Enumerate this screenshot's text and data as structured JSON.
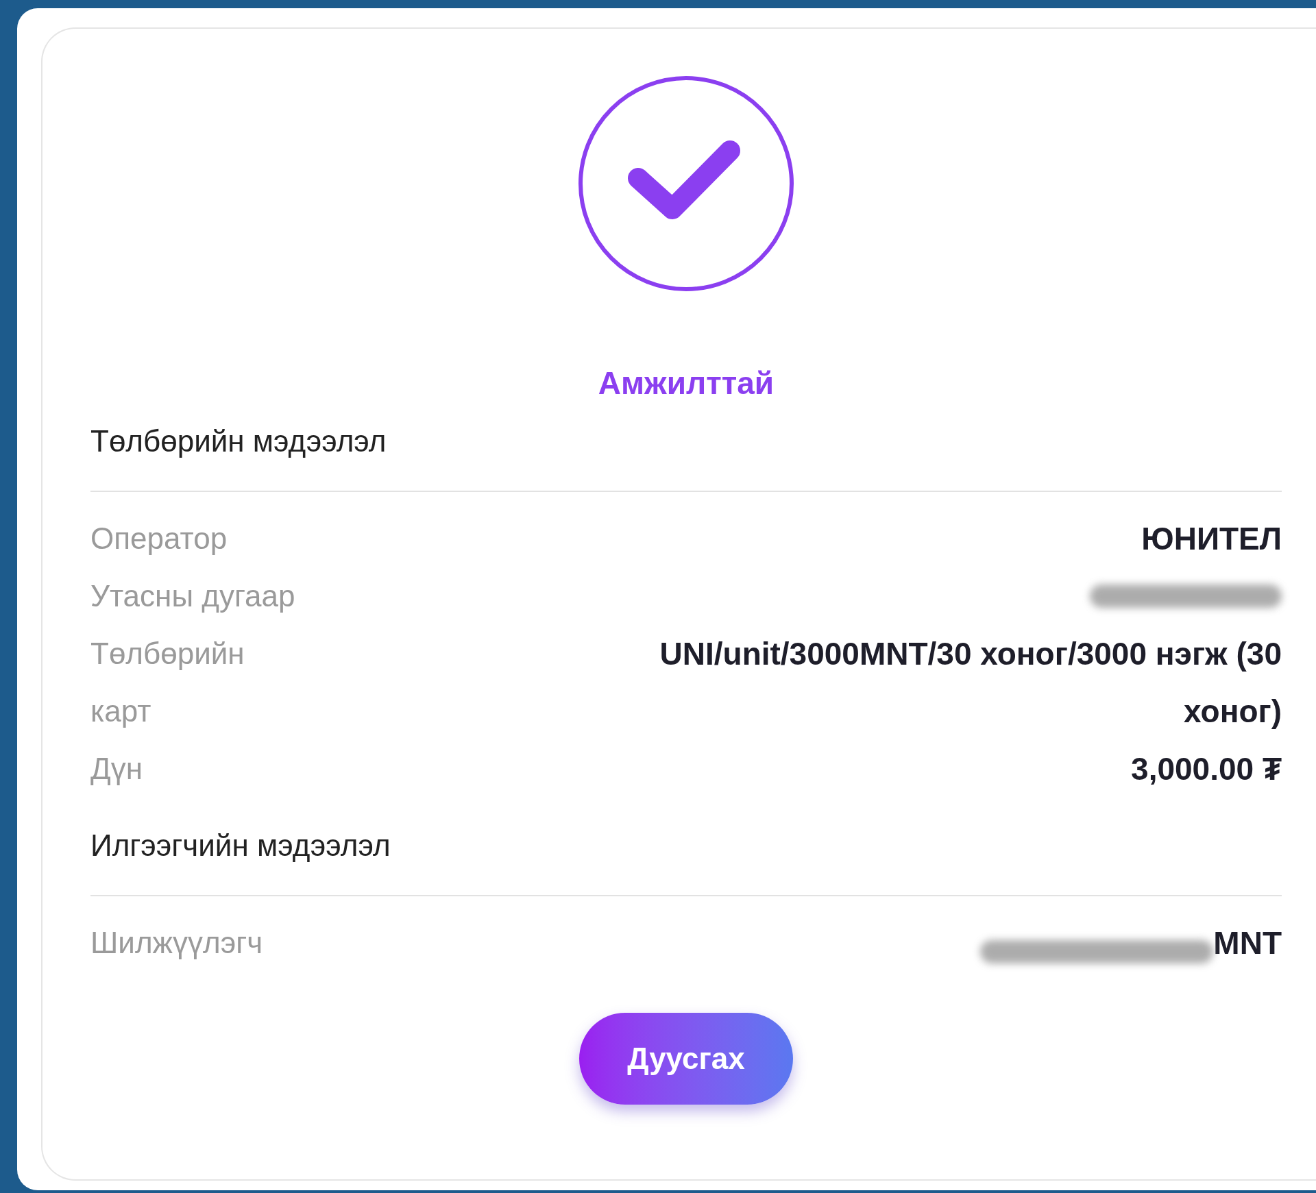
{
  "status": "Амжилттай",
  "sections": [
    {
      "heading": "Төлбөрийн мэдээлэл",
      "rows": [
        {
          "label": "Оператор",
          "value": "ЮНИТЕЛ",
          "redacted": false
        },
        {
          "label": "Утасны дугаар",
          "redacted": true
        },
        {
          "label": "Төлбөрийн карт",
          "value": "UNI/unit/3000MNT/30 хоног/3000 нэгж (30 хоног)",
          "redacted": false
        },
        {
          "label": "Дүн",
          "value": "3,000.00 ₮",
          "redacted": false
        }
      ]
    },
    {
      "heading": "Илгээгчийн мэдээлэл",
      "rows": [
        {
          "label": "Шилжүүлэгч",
          "value": "MNT",
          "redacted": true
        }
      ]
    }
  ],
  "button": "Дуусгах"
}
